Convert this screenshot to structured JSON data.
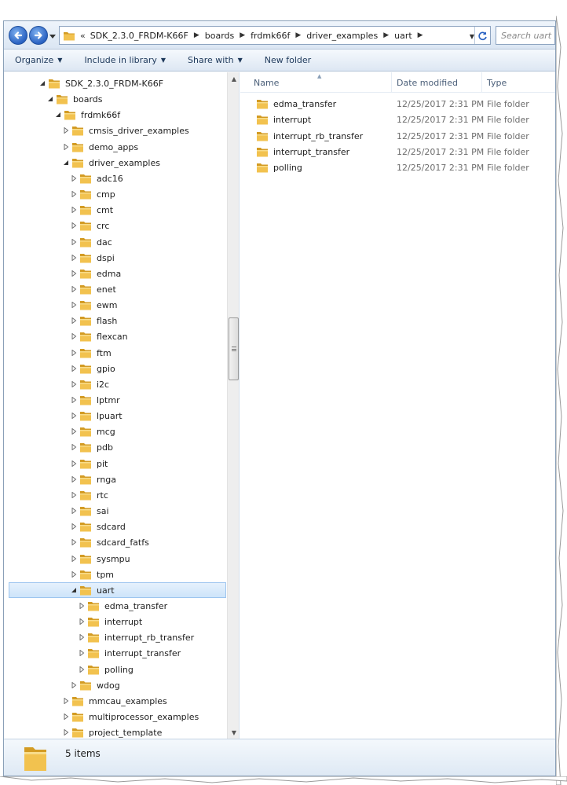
{
  "window": {
    "address_path": [
      "SDK_2.3.0_FRDM-K66F",
      "boards",
      "frdmk66f",
      "driver_examples",
      "uart"
    ],
    "address_overflow": "«",
    "search_placeholder": "Search uart"
  },
  "toolbar": {
    "items": [
      {
        "label": "Organize",
        "has_menu": true
      },
      {
        "label": "Include in library",
        "has_menu": true
      },
      {
        "label": "Share with",
        "has_menu": true
      },
      {
        "label": "New folder",
        "has_menu": false
      }
    ]
  },
  "tree": [
    {
      "label": "SDK_2.3.0_FRDM-K66F",
      "depth": 0,
      "state": "expanded"
    },
    {
      "label": "boards",
      "depth": 1,
      "state": "expanded"
    },
    {
      "label": "frdmk66f",
      "depth": 2,
      "state": "expanded"
    },
    {
      "label": "cmsis_driver_examples",
      "depth": 3,
      "state": "collapsed"
    },
    {
      "label": "demo_apps",
      "depth": 3,
      "state": "collapsed"
    },
    {
      "label": "driver_examples",
      "depth": 3,
      "state": "expanded"
    },
    {
      "label": "adc16",
      "depth": 4,
      "state": "collapsed"
    },
    {
      "label": "cmp",
      "depth": 4,
      "state": "collapsed"
    },
    {
      "label": "cmt",
      "depth": 4,
      "state": "collapsed"
    },
    {
      "label": "crc",
      "depth": 4,
      "state": "collapsed"
    },
    {
      "label": "dac",
      "depth": 4,
      "state": "collapsed"
    },
    {
      "label": "dspi",
      "depth": 4,
      "state": "collapsed"
    },
    {
      "label": "edma",
      "depth": 4,
      "state": "collapsed"
    },
    {
      "label": "enet",
      "depth": 4,
      "state": "collapsed"
    },
    {
      "label": "ewm",
      "depth": 4,
      "state": "collapsed"
    },
    {
      "label": "flash",
      "depth": 4,
      "state": "collapsed"
    },
    {
      "label": "flexcan",
      "depth": 4,
      "state": "collapsed"
    },
    {
      "label": "ftm",
      "depth": 4,
      "state": "collapsed"
    },
    {
      "label": "gpio",
      "depth": 4,
      "state": "collapsed"
    },
    {
      "label": "i2c",
      "depth": 4,
      "state": "collapsed"
    },
    {
      "label": "lptmr",
      "depth": 4,
      "state": "collapsed"
    },
    {
      "label": "lpuart",
      "depth": 4,
      "state": "collapsed"
    },
    {
      "label": "mcg",
      "depth": 4,
      "state": "collapsed"
    },
    {
      "label": "pdb",
      "depth": 4,
      "state": "collapsed"
    },
    {
      "label": "pit",
      "depth": 4,
      "state": "collapsed"
    },
    {
      "label": "rnga",
      "depth": 4,
      "state": "collapsed"
    },
    {
      "label": "rtc",
      "depth": 4,
      "state": "collapsed"
    },
    {
      "label": "sai",
      "depth": 4,
      "state": "collapsed"
    },
    {
      "label": "sdcard",
      "depth": 4,
      "state": "collapsed"
    },
    {
      "label": "sdcard_fatfs",
      "depth": 4,
      "state": "collapsed"
    },
    {
      "label": "sysmpu",
      "depth": 4,
      "state": "collapsed"
    },
    {
      "label": "tpm",
      "depth": 4,
      "state": "collapsed"
    },
    {
      "label": "uart",
      "depth": 4,
      "state": "expanded",
      "selected": true
    },
    {
      "label": "edma_transfer",
      "depth": 5,
      "state": "collapsed"
    },
    {
      "label": "interrupt",
      "depth": 5,
      "state": "collapsed"
    },
    {
      "label": "interrupt_rb_transfer",
      "depth": 5,
      "state": "collapsed"
    },
    {
      "label": "interrupt_transfer",
      "depth": 5,
      "state": "collapsed"
    },
    {
      "label": "polling",
      "depth": 5,
      "state": "collapsed"
    },
    {
      "label": "wdog",
      "depth": 4,
      "state": "collapsed"
    },
    {
      "label": "mmcau_examples",
      "depth": 3,
      "state": "collapsed"
    },
    {
      "label": "multiprocessor_examples",
      "depth": 3,
      "state": "collapsed"
    },
    {
      "label": "project_template",
      "depth": 3,
      "state": "collapsed"
    }
  ],
  "columns": {
    "name": "Name",
    "date": "Date modified",
    "type": "Type"
  },
  "files": [
    {
      "name": "edma_transfer",
      "date": "12/25/2017 2:31 PM",
      "type": "File folder"
    },
    {
      "name": "interrupt",
      "date": "12/25/2017 2:31 PM",
      "type": "File folder"
    },
    {
      "name": "interrupt_rb_transfer",
      "date": "12/25/2017 2:31 PM",
      "type": "File folder"
    },
    {
      "name": "interrupt_transfer",
      "date": "12/25/2017 2:31 PM",
      "type": "File folder"
    },
    {
      "name": "polling",
      "date": "12/25/2017 2:31 PM",
      "type": "File folder"
    }
  ],
  "status": {
    "item_count": "5 items"
  },
  "icons": {
    "back": "back-arrow-icon",
    "forward": "forward-arrow-icon",
    "folder": "folder-icon",
    "refresh": "refresh-icon",
    "search": "search-icon",
    "expand": "triangle-expand-icon",
    "collapse": "triangle-collapse-icon"
  },
  "colors": {
    "folder_fill": "#f2c24f",
    "folder_dark": "#d39b23",
    "selection_bg": "#cde4fa",
    "selection_border": "#9dc5ef",
    "nav_button": "#2a62c2",
    "header_text": "#4c607a",
    "toolbar_text": "#1e395b"
  }
}
